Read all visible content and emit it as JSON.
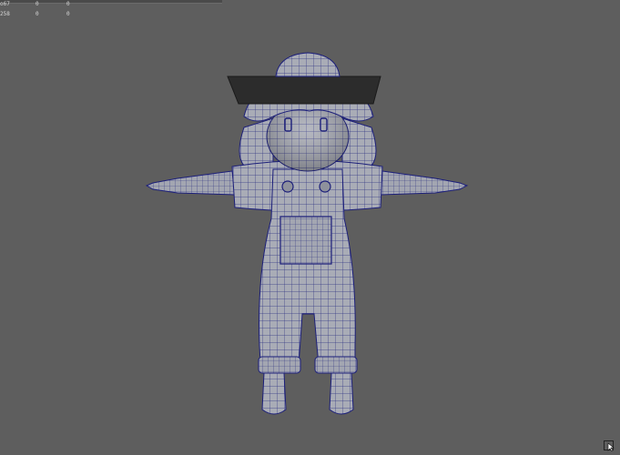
{
  "viewport": {
    "background": "#5e5e5e",
    "model_name": "chibi-farmer-character-wireframe"
  },
  "hud": {
    "rows": [
      {
        "label": "o67",
        "col1": "0",
        "col2": "0"
      },
      {
        "label": "258",
        "col1": "0",
        "col2": "0"
      }
    ]
  },
  "corner": {
    "icon": "cursor-icon"
  },
  "colors": {
    "mesh_fill": "#a9acb6",
    "wire": "#1c1f7a",
    "hat_brim": "#2c2c2c"
  }
}
